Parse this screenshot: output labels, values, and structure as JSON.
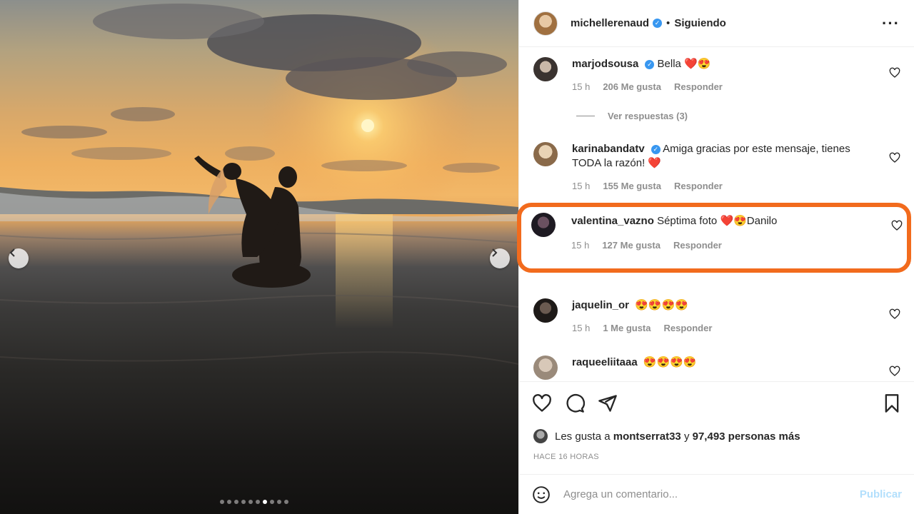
{
  "post": {
    "carousel": {
      "slide_count": 10,
      "active_slide": 6
    }
  },
  "header": {
    "username": "michellerenaud",
    "separator": "•",
    "follow_status": "Siguiendo",
    "more_icon": "more-horizontal-icon"
  },
  "comments": [
    {
      "username": "marjodsousa",
      "verified": true,
      "text": "Bella ❤️😍",
      "time": "15 h",
      "likes": "206 Me gusta",
      "reply": "Responder",
      "replies_label": "Ver respuestas (3)"
    },
    {
      "username": "karinabandatv",
      "verified": true,
      "text": "Amiga gracias por este mensaje, tienes TODA la razón! ❤️",
      "time": "15 h",
      "likes": "155 Me gusta",
      "reply": "Responder"
    },
    {
      "username": "valentina_vazno",
      "verified": false,
      "text": "Séptima foto ❤️😍Danilo",
      "time": "15 h",
      "likes": "127 Me gusta",
      "reply": "Responder"
    },
    {
      "username": "jaquelin_or",
      "verified": false,
      "text": "😍😍😍😍",
      "time": "15 h",
      "likes": "1 Me gusta",
      "reply": "Responder"
    },
    {
      "username": "raqueeliitaaa",
      "verified": false,
      "text": "😍😍😍😍",
      "time": "",
      "likes": "",
      "reply": ""
    }
  ],
  "likes": {
    "prefix": "Les gusta a",
    "user": "montserrat33",
    "middle": "y",
    "count": "97,493 personas más"
  },
  "timestamp": "HACE 16 HORAS",
  "comment_box": {
    "placeholder": "Agrega un comentario...",
    "publish": "Publicar"
  },
  "colors": {
    "highlight": "#f26b1d",
    "verified": "#3897f0",
    "publish": "#b2dffc"
  }
}
